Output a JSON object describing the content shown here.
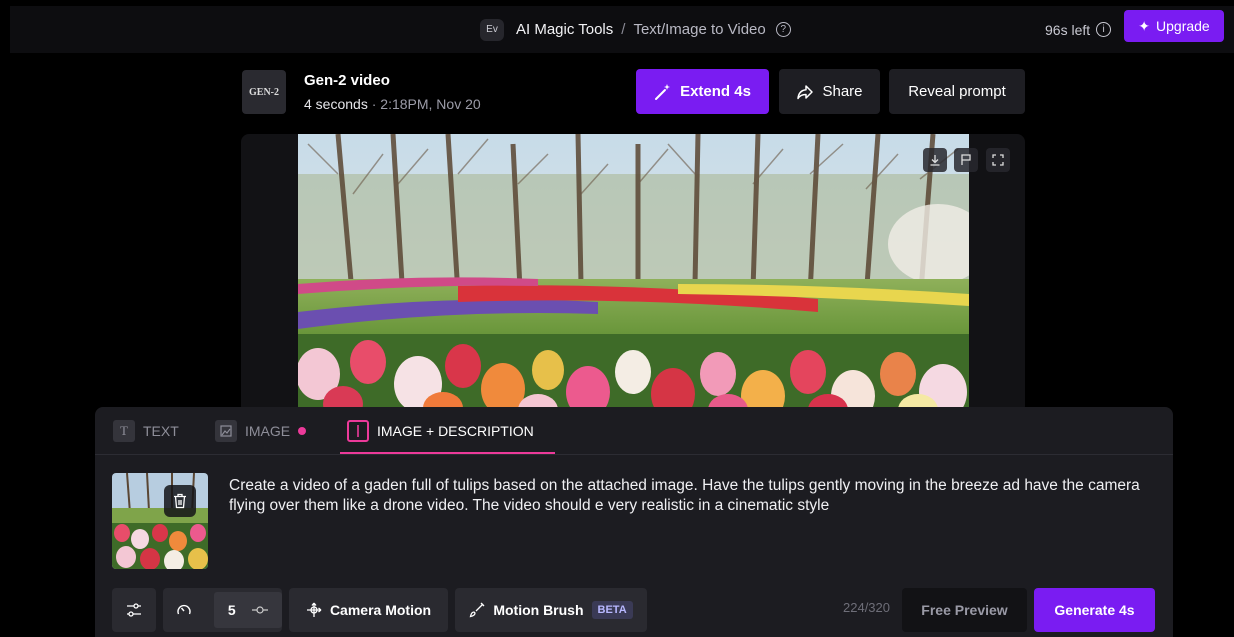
{
  "topbar": {
    "workspace_badge": "Ev",
    "breadcrumb_main": "AI Magic Tools",
    "breadcrumb_sep": "/",
    "breadcrumb_sub": "Text/Image to Video",
    "credits_left": "96s left",
    "upgrade_label": "Upgrade"
  },
  "generation": {
    "thumb_label": "GEN-2",
    "title": "Gen-2 video",
    "duration": "4 seconds",
    "meta_sep": "·",
    "timestamp": "2:18PM, Nov 20",
    "extend_label": "Extend 4s",
    "share_label": "Share",
    "reveal_label": "Reveal prompt"
  },
  "tabs": [
    {
      "label": "TEXT",
      "icon": "T"
    },
    {
      "label": "IMAGE"
    },
    {
      "label": "IMAGE + DESCRIPTION"
    }
  ],
  "prompt": {
    "text": "Create a video of a gaden full of tulips based on the attached image. Have the tulips gently moving in the breeze ad have the camera flying over them like a drone video. The video should e very realistic in a cinematic style",
    "char_count": "224/320"
  },
  "controls": {
    "speed_value": "5",
    "camera_motion_label": "Camera Motion",
    "motion_brush_label": "Motion Brush",
    "beta_badge": "BETA",
    "free_preview_label": "Free Preview",
    "generate_label": "Generate 4s"
  },
  "colors": {
    "accent_purple": "#7a1cf2",
    "accent_pink": "#ec3a9a",
    "panel_bg": "#1c1c21"
  }
}
